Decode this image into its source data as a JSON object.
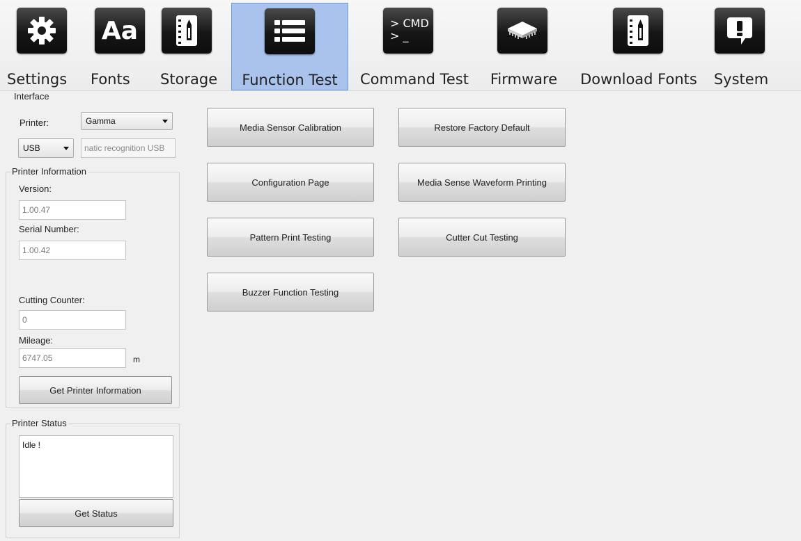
{
  "toolbar": {
    "tabs": [
      {
        "label": "Settings",
        "icon": "gear-icon"
      },
      {
        "label": "Fonts",
        "icon": "fonts-icon",
        "icon_text": "Aa"
      },
      {
        "label": "Storage",
        "icon": "notebook-icon"
      },
      {
        "label": "Function Test",
        "icon": "list-icon",
        "active": true
      },
      {
        "label": "Command Test",
        "icon": "terminal-icon",
        "icon_line1": "> CMD",
        "icon_line2": "> _"
      },
      {
        "label": "Firmware",
        "icon": "chip-icon"
      },
      {
        "label": "Download Fonts",
        "icon": "notebook-icon"
      },
      {
        "label": "System",
        "icon": "alert-bubble-icon"
      }
    ]
  },
  "interface": {
    "title": "Interface",
    "printer_label": "Printer:",
    "printer_value": "Gamma",
    "port_value": "USB",
    "port_info": "natic recognition USB"
  },
  "printer_info": {
    "title": "Printer Information",
    "version_label": "Version:",
    "version_value": "1.00.47",
    "serial_label": "Serial Number:",
    "serial_value": "1.00.42",
    "cutting_label": "Cutting Counter:",
    "cutting_value": "0",
    "mileage_label": "Mileage:",
    "mileage_value": "6747.05",
    "mileage_unit": "m",
    "get_info_button": "Get Printer Information"
  },
  "printer_status": {
    "title": "Printer Status",
    "status_text": "Idle !",
    "get_status_button": "Get Status"
  },
  "function_tests": {
    "media_sensor": "Media Sensor Calibration",
    "restore_default": "Restore Factory Default",
    "config_page": "Configuration Page",
    "waveform": "Media Sense Waveform Printing",
    "pattern_print": "Pattern Print Testing",
    "cutter_cut": "Cutter Cut Testing",
    "buzzer": "Buzzer Function Testing"
  }
}
